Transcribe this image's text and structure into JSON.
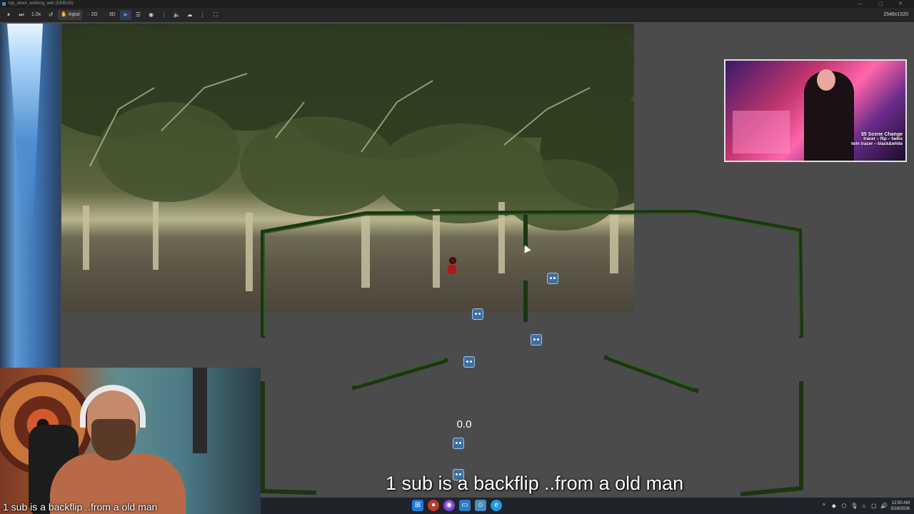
{
  "window": {
    "title": "top_down_working_well (DEBUG)",
    "controls": "— ▢ ✕"
  },
  "toolbar": {
    "speed": "1.0x",
    "input_label": "Input",
    "mode_2d": "2D",
    "mode_3d": "3D",
    "resolution": "2548x1320",
    "icons": [
      "pause-icon",
      "frame-step-icon",
      "speed-dropdown",
      "reset-speed-icon",
      "input-icon",
      "2d-mode",
      "3d-mode",
      "select-icon",
      "list-icon",
      "visibility-icon",
      "more-icon",
      "audio-icon",
      "camera-override-icon",
      "camera-menu-icon",
      "fullscreen-icon"
    ]
  },
  "game": {
    "timer": "0.0"
  },
  "stream_overlay": {
    "pip_text_line1": "$5 Scene Change",
    "pip_text_line2": "tracer – flip – fades",
    "pip_text_line3": "twin tracer – black&white",
    "caption": "1 sub is a backflip ..from a old man"
  },
  "taskbar": {
    "time": "12:50 AM",
    "date": "3/28/2026",
    "apps": [
      "windows-start-icon",
      "chrome-icon",
      "discord-icon",
      "files-icon",
      "godot-icon",
      "edge-icon"
    ]
  },
  "colors": {
    "wall": "#1f3a14",
    "wall_highlight": "#2f5a1f",
    "godot_blue": "#478cbf",
    "viewport_bg": "#4b4b4b"
  }
}
